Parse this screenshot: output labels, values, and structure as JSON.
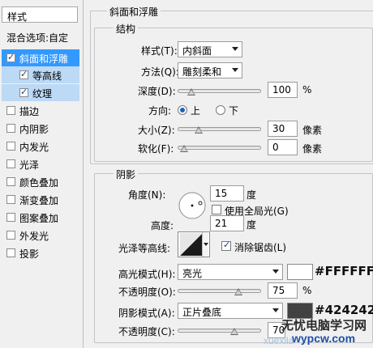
{
  "sidebar": {
    "title": "样式",
    "blend_options": "混合选项:自定",
    "items": [
      {
        "label": "斜面和浮雕",
        "checked": true
      },
      {
        "label": "等高线",
        "checked": true
      },
      {
        "label": "纹理",
        "checked": true
      },
      {
        "label": "描边",
        "checked": false
      },
      {
        "label": "内阴影",
        "checked": false
      },
      {
        "label": "内发光",
        "checked": false
      },
      {
        "label": "光泽",
        "checked": false
      },
      {
        "label": "颜色叠加",
        "checked": false
      },
      {
        "label": "渐变叠加",
        "checked": false
      },
      {
        "label": "图案叠加",
        "checked": false
      },
      {
        "label": "外发光",
        "checked": false
      },
      {
        "label": "投影",
        "checked": false
      }
    ]
  },
  "bevel": {
    "section_title": "斜面和浮雕",
    "structure_title": "结构",
    "style_label": "样式(T):",
    "style_value": "内斜面",
    "technique_label": "方法(Q):",
    "technique_value": "雕刻柔和",
    "depth_label": "深度(D):",
    "depth_value": "100",
    "depth_unit": "%",
    "depth_level": 0.1,
    "direction_label": "方向:",
    "direction_up": "上",
    "direction_down": "下",
    "size_label": "大小(Z):",
    "size_value": "30",
    "size_unit": "像素",
    "size_level": 0.2,
    "soften_label": "软化(F):",
    "soften_value": "0",
    "soften_unit": "像素",
    "soften_level": 0.0
  },
  "shading": {
    "section_title": "阴影",
    "angle_label": "角度(N):",
    "angle_value": "15",
    "angle_unit": "度",
    "global_light_label": "使用全局光(G)",
    "altitude_label": "高度:",
    "altitude_value": "21",
    "altitude_unit": "度",
    "gloss_contour_label": "光泽等高线:",
    "anti_alias_label": "消除锯齿(L)",
    "highlight_mode_label": "高光模式(H):",
    "highlight_mode_value": "亮光",
    "highlight_color": "#FFFFFF",
    "highlight_hex": "#FFFFFF",
    "highlight_opacity_label": "不透明度(O):",
    "highlight_opacity_value": "75",
    "highlight_opacity_unit": "%",
    "highlight_opacity_level": 0.75,
    "shadow_mode_label": "阴影模式(A):",
    "shadow_mode_value": "正片叠底",
    "shadow_color": "#424242",
    "shadow_hex": "#424242",
    "shadow_opacity_label": "不透明度(C):",
    "shadow_opacity_value": "70",
    "shadow_opacity_level": 0.7
  },
  "watermark": {
    "line1": "无忧电脑学习网",
    "line2": "wypcw.com",
    "faint": "xuexila"
  }
}
